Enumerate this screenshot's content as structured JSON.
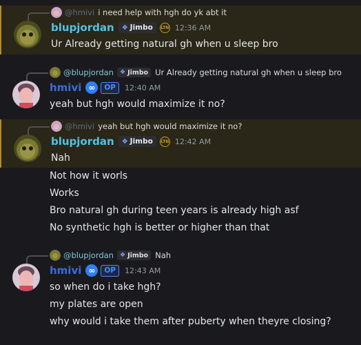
{
  "messages": [
    {
      "reply": {
        "author": "@hmivi",
        "text": "i need help with hgh do yk abt it"
      },
      "author": "blupjordan",
      "tag": "Jimbo",
      "badge": "LTN",
      "time": "12:36 AM",
      "lines": [
        "Ur Already getting natural gh when u sleep bro"
      ]
    },
    {
      "reply": {
        "author": "@blupjordan",
        "tag": "Jimbo",
        "text": "Ur Already getting natural gh when u sleep bro"
      },
      "author": "hmivi",
      "role": "OP",
      "time": "12:40 AM",
      "lines": [
        "yeah but hgh would maximize it no?"
      ]
    },
    {
      "reply": {
        "author": "@hmivi",
        "text": "yeah but hgh would maximize it no?"
      },
      "author": "blupjordan",
      "tag": "Jimbo",
      "badge": "LTN",
      "time": "12:42 AM",
      "lines": [
        "Nah",
        "Not how it worls",
        "Works",
        "Bro natural gh during teen years is already high asf",
        "No synthetic hgh is better or higher than that"
      ]
    },
    {
      "reply": {
        "author": "@blupjordan",
        "tag": "Jimbo",
        "text": "Nah"
      },
      "author": "hmivi",
      "role": "OP",
      "time": "12:43 AM",
      "lines": [
        "so when do i take hgh?",
        "my plates are open",
        "why would i take them after puberty when theyre closing?"
      ]
    }
  ],
  "icons": {
    "server_tag": "diamond-icon",
    "infinity_badge": "infinity-icon"
  },
  "colors": {
    "highlight_bg": "#2a2618",
    "highlight_bar": "#b58a28",
    "blupjordan": "#4fc3e8",
    "hmivi": "#3d6bd8"
  }
}
